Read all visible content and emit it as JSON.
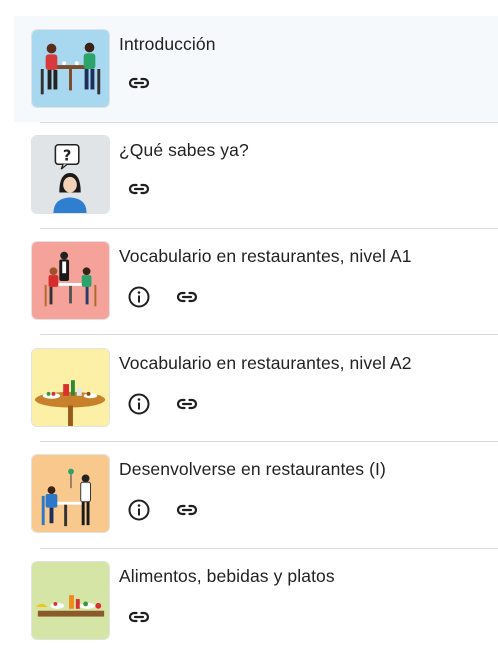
{
  "items": [
    {
      "title": "Introducción",
      "thumb_icon": "restaurant-couple-illustration",
      "thumb_bg": "#a8d8f0",
      "has_info": false,
      "has_link": true,
      "highlighted": true
    },
    {
      "title": "¿Qué sabes ya?",
      "thumb_icon": "question-person-illustration",
      "thumb_bg": "#e1e4e6",
      "has_info": false,
      "has_link": true,
      "highlighted": false
    },
    {
      "title": "Vocabulario en restaurantes, nivel A1",
      "thumb_icon": "waiter-table-illustration",
      "thumb_bg": "#f4a29a",
      "has_info": true,
      "has_link": true,
      "highlighted": false
    },
    {
      "title": "Vocabulario en restaurantes, nivel A2",
      "thumb_icon": "table-drinks-illustration",
      "thumb_bg": "#fbf0a6",
      "has_info": true,
      "has_link": true,
      "highlighted": false
    },
    {
      "title": "Desenvolverse en restaurantes (I)",
      "thumb_icon": "waiter-serving-illustration",
      "thumb_bg": "#f9c88c",
      "has_info": true,
      "has_link": true,
      "highlighted": false
    },
    {
      "title": "Alimentos, bebidas y platos",
      "thumb_icon": "food-tray-illustration",
      "thumb_bg": "#d4e5a6",
      "has_info": false,
      "has_link": true,
      "highlighted": false
    }
  ],
  "colors": {
    "highlight_bg": "#f6f9fb",
    "divider": "#d9d9d9",
    "icon": "#1f1f1f",
    "text": "#222222"
  }
}
